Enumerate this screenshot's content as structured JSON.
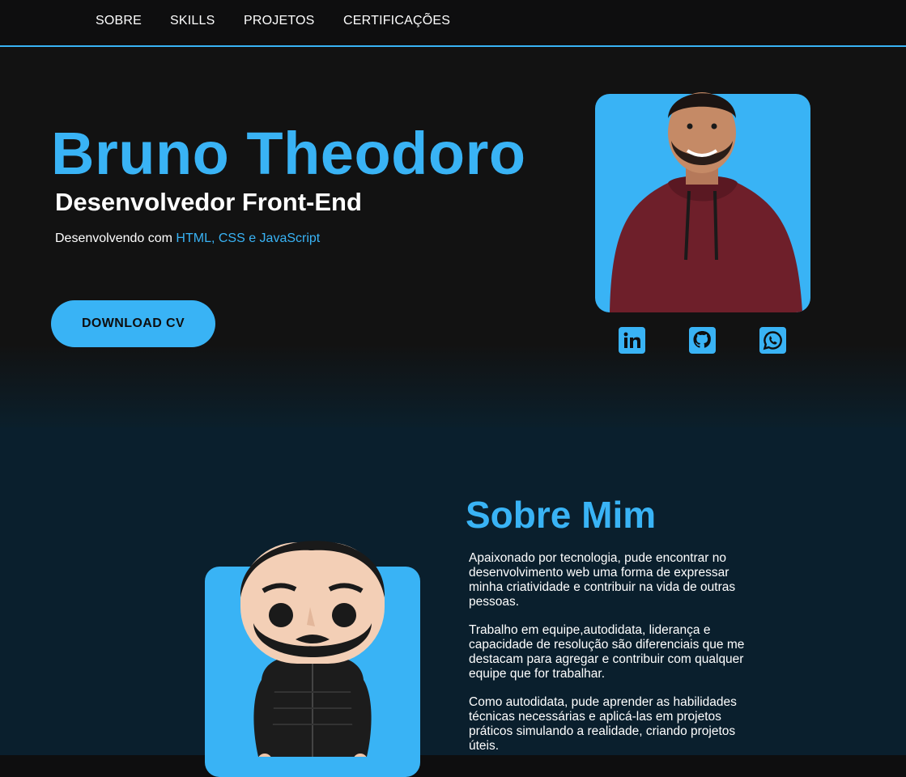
{
  "nav": {
    "items": [
      "SOBRE",
      "SKILLS",
      "PROJETOS",
      "CERTIFICAÇÕES"
    ]
  },
  "hero": {
    "name": "Bruno Theodoro",
    "role": "Desenvolvedor Front-End",
    "tagline_prefix": "Desenvolvendo com ",
    "tagline_highlight": "HTML, CSS e JavaScript",
    "download_label": "DOWNLOAD CV",
    "socials": [
      {
        "icon": "linkedin-icon"
      },
      {
        "icon": "github-icon"
      },
      {
        "icon": "whatsapp-icon"
      }
    ]
  },
  "about": {
    "title": "Sobre Mim",
    "paragraphs": [
      "Apaixonado por tecnologia, pude encontrar no desenvolvimento web uma forma de expressar minha criatividade e contribuir na vida de outras pessoas.",
      "Trabalho em equipe,autodidata, liderança e capacidade de resolução são diferenciais que me destacam para agregar e contribuir com qualquer equipe que for trabalhar.",
      "Como autodidata, pude aprender as habilidades técnicas necessárias e aplicá-las em projetos práticos simulando a realidade, criando projetos úteis."
    ]
  },
  "colors": {
    "accent": "#39b3f5",
    "background": "#121212",
    "about_background": "#0a1f2d"
  }
}
